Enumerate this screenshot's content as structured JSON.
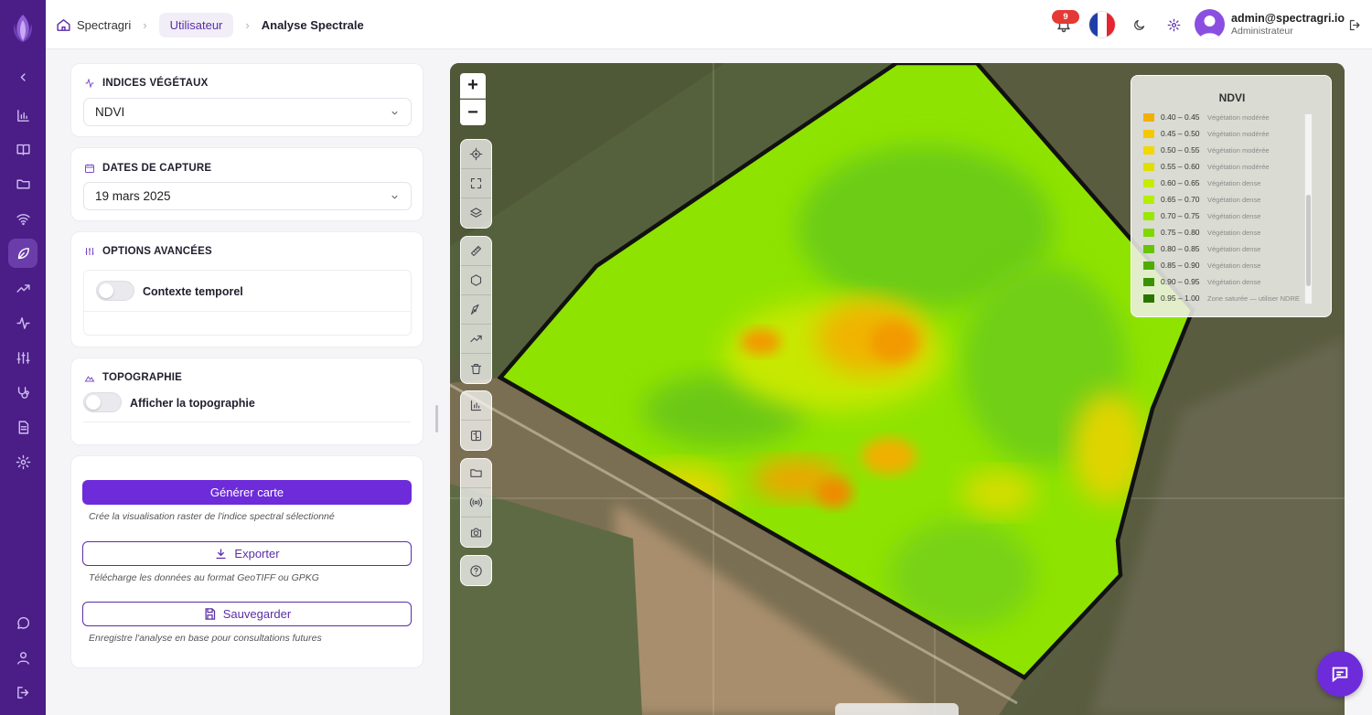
{
  "breadcrumb": {
    "home": "Spectragri",
    "section": "Utilisateur",
    "current": "Analyse Spectrale"
  },
  "topbar": {
    "notification_count": "9",
    "user_email": "admin@spectragri.io",
    "user_role": "Administrateur"
  },
  "panel": {
    "indices": {
      "title": "INDICES VÉGÉTAUX",
      "selected": "NDVI"
    },
    "dates": {
      "title": "DATES DE CAPTURE",
      "selected": "19 mars 2025"
    },
    "advanced": {
      "title": "OPTIONS AVANCÉES",
      "temporal_label": "Contexte temporel"
    },
    "topography": {
      "title": "TOPOGRAPHIE",
      "toggle_label": "Afficher la topographie"
    },
    "actions": {
      "generate": "Générer carte",
      "generate_hint": "Crée la visualisation raster de l'indice spectral sélectionné",
      "export": "Exporter",
      "export_hint": "Télécharge les données au format GeoTIFF ou GPKG",
      "save": "Sauvegarder",
      "save_hint": "Enregistre l'analyse en base pour consultations futures"
    }
  },
  "map": {
    "zoom_in": "+",
    "zoom_out": "−",
    "legend": {
      "title": "NDVI",
      "items": [
        {
          "range": "0.40 – 0.45",
          "label": "Végétation modérée",
          "color": "#f2b100"
        },
        {
          "range": "0.45 – 0.50",
          "label": "Végétation modérée",
          "color": "#f5c800"
        },
        {
          "range": "0.50 – 0.55",
          "label": "Végétation modérée",
          "color": "#f0d800"
        },
        {
          "range": "0.55 – 0.60",
          "label": "Végétation modérée",
          "color": "#e0e000"
        },
        {
          "range": "0.60 – 0.65",
          "label": "Végétation dense",
          "color": "#c8ec00"
        },
        {
          "range": "0.65 – 0.70",
          "label": "Végétation dense",
          "color": "#b2f000"
        },
        {
          "range": "0.70 – 0.75",
          "label": "Végétation dense",
          "color": "#98e800"
        },
        {
          "range": "0.75 – 0.80",
          "label": "Végétation dense",
          "color": "#7fd800"
        },
        {
          "range": "0.80 – 0.85",
          "label": "Végétation dense",
          "color": "#66c400"
        },
        {
          "range": "0.85 – 0.90",
          "label": "Végétation dense",
          "color": "#4eac00"
        },
        {
          "range": "0.90 – 0.95",
          "label": "Végétation dense",
          "color": "#3a9200"
        },
        {
          "range": "0.95 – 1.00",
          "label": "Zone saturée — utiliser NDRE",
          "color": "#2a7400"
        }
      ]
    }
  },
  "colors": {
    "sidebar": "#4b1d86",
    "accent": "#6d2bd9",
    "notification": "#e53935"
  }
}
